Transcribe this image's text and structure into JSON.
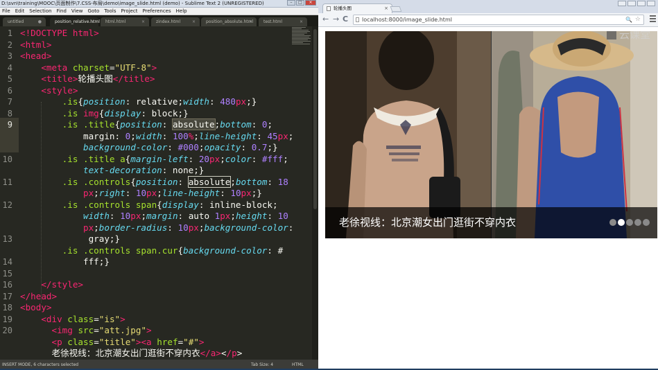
{
  "sublime": {
    "title": "D:\\svn\\training\\MOOC\\页面制作\\7.CSS-布局\\demo\\image_slide.html (demo) - Sublime Text 2 (UNREGISTERED)",
    "menu": [
      "File",
      "Edit",
      "Selection",
      "Find",
      "View",
      "Goto",
      "Tools",
      "Project",
      "Preferences",
      "Help"
    ],
    "tabs": [
      {
        "label": "untitled",
        "close": "●"
      },
      {
        "label": "position_relative.html",
        "close": "×"
      },
      {
        "label": "html.html",
        "close": "×"
      },
      {
        "label": "zindex.html",
        "close": "×"
      },
      {
        "label": "position_absolute.html",
        "close": "×"
      },
      {
        "label": "test.html",
        "close": "×"
      }
    ],
    "line_numbers": [
      "1",
      "2",
      "3",
      "4",
      "5",
      "6",
      "7",
      "8",
      "9",
      "",
      "",
      "10",
      "",
      "11",
      "",
      "12",
      "",
      "",
      "13",
      "",
      "14",
      "15",
      "16",
      "17",
      "18",
      "19",
      "20"
    ],
    "status": {
      "left": "INSERT MODE, 6 characters selected",
      "tab_size": "Tab Size: 4",
      "syntax": "HTML"
    }
  },
  "code_lines": [
    [
      [
        "t",
        "<!DOCTYPE html>"
      ]
    ],
    [
      [
        "t",
        "<html>"
      ]
    ],
    [
      [
        "t",
        "<head>"
      ]
    ],
    [
      [
        "x",
        "    "
      ],
      [
        "t",
        "<meta"
      ],
      [
        "x",
        " "
      ],
      [
        "a",
        "charset"
      ],
      [
        "x",
        "="
      ],
      [
        "s",
        "\"UTF-8\""
      ],
      [
        "t",
        ">"
      ]
    ],
    [
      [
        "x",
        "    "
      ],
      [
        "t",
        "<title>"
      ],
      [
        "x",
        "轮播头图"
      ],
      [
        "t",
        "</title>"
      ]
    ],
    [
      [
        "x",
        "    "
      ],
      [
        "t",
        "<style>"
      ]
    ],
    [
      [
        "x",
        "        "
      ],
      [
        "a",
        ".is"
      ],
      [
        "x",
        "{"
      ],
      [
        "p",
        "position"
      ],
      [
        "x",
        ": relative;"
      ],
      [
        "p",
        "width"
      ],
      [
        "x",
        ": "
      ],
      [
        "n",
        "480"
      ],
      [
        "t",
        "px"
      ],
      [
        "x",
        ";}"
      ]
    ],
    [
      [
        "x",
        "        "
      ],
      [
        "a",
        ".is"
      ],
      [
        "x",
        " "
      ],
      [
        "t",
        "img"
      ],
      [
        "x",
        "{"
      ],
      [
        "p",
        "display"
      ],
      [
        "x",
        ": block;}"
      ]
    ],
    [
      [
        "x",
        "        "
      ],
      [
        "a",
        ".is .title"
      ],
      [
        "x",
        "{"
      ],
      [
        "p",
        "position"
      ],
      [
        "x",
        ": "
      ],
      [
        "sel",
        "absolute"
      ],
      [
        "x",
        ";"
      ],
      [
        "p",
        "bottom"
      ],
      [
        "x",
        ": "
      ],
      [
        "n",
        "0"
      ],
      [
        "x",
        ";"
      ]
    ],
    [
      [
        "x",
        "            margin: "
      ],
      [
        "n",
        "0"
      ],
      [
        "x",
        ";"
      ],
      [
        "p",
        "width"
      ],
      [
        "x",
        ": "
      ],
      [
        "n",
        "100"
      ],
      [
        "t",
        "%"
      ],
      [
        "x",
        ";"
      ],
      [
        "p",
        "line-height"
      ],
      [
        "x",
        ": "
      ],
      [
        "n",
        "45"
      ],
      [
        "t",
        "px"
      ],
      [
        "x",
        ";"
      ]
    ],
    [
      [
        "x",
        "            "
      ],
      [
        "p",
        "background-color"
      ],
      [
        "x",
        ": "
      ],
      [
        "n",
        "#000"
      ],
      [
        "x",
        ";"
      ],
      [
        "p",
        "opacity"
      ],
      [
        "x",
        ": "
      ],
      [
        "n",
        "0.7"
      ],
      [
        "x",
        ";}"
      ]
    ],
    [
      [
        "x",
        "        "
      ],
      [
        "a",
        ".is .title a"
      ],
      [
        "x",
        "{"
      ],
      [
        "p",
        "margin-left"
      ],
      [
        "x",
        ": "
      ],
      [
        "n",
        "20"
      ],
      [
        "t",
        "px"
      ],
      [
        "x",
        ";"
      ],
      [
        "p",
        "color"
      ],
      [
        "x",
        ": "
      ],
      [
        "n",
        "#fff"
      ],
      [
        "x",
        ";"
      ]
    ],
    [
      [
        "x",
        "            "
      ],
      [
        "p",
        "text-decoration"
      ],
      [
        "x",
        ": none;}"
      ]
    ],
    [
      [
        "x",
        "        "
      ],
      [
        "a",
        ".is .controls"
      ],
      [
        "x",
        "{"
      ],
      [
        "p",
        "position"
      ],
      [
        "x",
        ": "
      ],
      [
        "box",
        "absolute"
      ],
      [
        "x",
        ";"
      ],
      [
        "p",
        "bottom"
      ],
      [
        "x",
        ": "
      ],
      [
        "n",
        "18"
      ]
    ],
    [
      [
        "x",
        "            "
      ],
      [
        "t",
        "px"
      ],
      [
        "x",
        ";"
      ],
      [
        "p",
        "right"
      ],
      [
        "x",
        ": "
      ],
      [
        "n",
        "10"
      ],
      [
        "t",
        "px"
      ],
      [
        "x",
        ";"
      ],
      [
        "p",
        "line-height"
      ],
      [
        "x",
        ": "
      ],
      [
        "n",
        "10"
      ],
      [
        "t",
        "px"
      ],
      [
        "x",
        ";}"
      ]
    ],
    [
      [
        "x",
        "        "
      ],
      [
        "a",
        ".is .controls span"
      ],
      [
        "x",
        "{"
      ],
      [
        "p",
        "display"
      ],
      [
        "x",
        ": inline-block;"
      ]
    ],
    [
      [
        "x",
        "            "
      ],
      [
        "p",
        "width"
      ],
      [
        "x",
        ": "
      ],
      [
        "n",
        "10"
      ],
      [
        "t",
        "px"
      ],
      [
        "x",
        ";"
      ],
      [
        "p",
        "margin"
      ],
      [
        "x",
        ": auto "
      ],
      [
        "n",
        "1"
      ],
      [
        "t",
        "px"
      ],
      [
        "x",
        ";"
      ],
      [
        "p",
        "height"
      ],
      [
        "x",
        ": "
      ],
      [
        "n",
        "10"
      ]
    ],
    [
      [
        "x",
        "            "
      ],
      [
        "t",
        "px"
      ],
      [
        "x",
        ";"
      ],
      [
        "p",
        "border-radius"
      ],
      [
        "x",
        ": "
      ],
      [
        "n",
        "10"
      ],
      [
        "t",
        "px"
      ],
      [
        "x",
        ";"
      ],
      [
        "p",
        "background-color"
      ],
      [
        "x",
        ":"
      ]
    ],
    [
      [
        "x",
        "             gray;}"
      ]
    ],
    [
      [
        "x",
        "        "
      ],
      [
        "a",
        ".is .controls span.cur"
      ],
      [
        "x",
        "{"
      ],
      [
        "p",
        "background-color"
      ],
      [
        "x",
        ": #"
      ]
    ],
    [
      [
        "x",
        "            fff;}"
      ]
    ],
    [
      [
        "x",
        ""
      ]
    ],
    [
      [
        "x",
        "    "
      ],
      [
        "t",
        "</style>"
      ]
    ],
    [
      [
        "t",
        "</head>"
      ]
    ],
    [
      [
        "t",
        "<body>"
      ]
    ],
    [
      [
        "x",
        "    "
      ],
      [
        "t",
        "<div"
      ],
      [
        "x",
        " "
      ],
      [
        "a",
        "class"
      ],
      [
        "x",
        "="
      ],
      [
        "s",
        "\"is\""
      ],
      [
        "t",
        ">"
      ]
    ],
    [
      [
        "x",
        "      "
      ],
      [
        "t",
        "<img"
      ],
      [
        "x",
        " "
      ],
      [
        "a",
        "src"
      ],
      [
        "x",
        "="
      ],
      [
        "s",
        "\"att.jpg\""
      ],
      [
        "t",
        ">"
      ]
    ],
    [
      [
        "x",
        "      "
      ],
      [
        "t",
        "<p"
      ],
      [
        "x",
        " "
      ],
      [
        "a",
        "class"
      ],
      [
        "x",
        "="
      ],
      [
        "s",
        "\"title\""
      ],
      [
        "t",
        ">"
      ],
      [
        "t",
        "<a"
      ],
      [
        "x",
        " "
      ],
      [
        "a",
        "href"
      ],
      [
        "x",
        "="
      ],
      [
        "s",
        "\"#\""
      ],
      [
        "t",
        ">"
      ]
    ],
    [
      [
        "x",
        "      老徐视线：北京潮女出门逛街不穿内衣"
      ],
      [
        "t",
        "</a>"
      ],
      [
        "x",
        "<"
      ],
      [
        "t",
        "/p"
      ],
      [
        "x",
        ">"
      ]
    ]
  ],
  "chrome": {
    "tab_title": "轮播头图",
    "tab_close": "×",
    "back": "←",
    "forward": "→",
    "reload": "C",
    "url": "localhost:8000/image_slide.html",
    "zoom_icon": "🔍",
    "star_icon": "☆",
    "watermark": "云课堂"
  },
  "slider": {
    "caption": "老徐视线：北京潮女出门逛街不穿内衣",
    "dots": [
      false,
      true,
      false,
      false,
      false
    ]
  }
}
